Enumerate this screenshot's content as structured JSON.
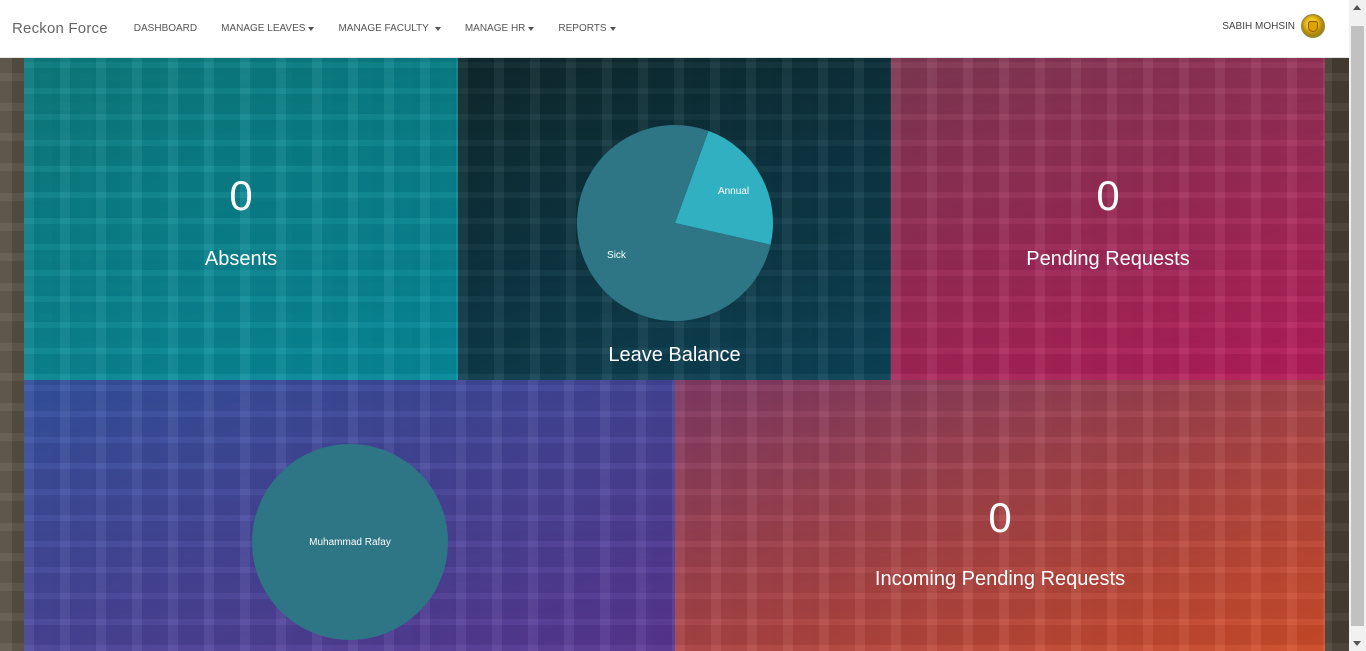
{
  "navbar": {
    "brand": "Reckon Force",
    "items": [
      {
        "label": "DASHBOARD",
        "dropdown": false
      },
      {
        "label": "MANAGE LEAVES",
        "dropdown": true
      },
      {
        "label": "MANAGE FACULTY",
        "dropdown": true
      },
      {
        "label": "MANAGE HR",
        "dropdown": true
      },
      {
        "label": "REPORTS",
        "dropdown": true
      }
    ],
    "user_name": "SABIH MOHSIN"
  },
  "tiles": {
    "absents": {
      "value": "0",
      "label": "Absents"
    },
    "leave_balance": {
      "label": "Leave Balance"
    },
    "pending": {
      "value": "0",
      "label": "Pending Requests"
    },
    "incoming": {
      "value": "0",
      "label": "Incoming Pending Requests"
    }
  },
  "chart_data": [
    {
      "type": "pie",
      "categories": [
        "Annual",
        "Sick"
      ],
      "values": [
        23,
        77
      ],
      "colors": [
        "#30b0c0",
        "#2e7585"
      ]
    },
    {
      "type": "pie",
      "categories": [
        "Muhammad Rafay"
      ],
      "values": [
        100
      ],
      "colors": [
        "#2e7585"
      ]
    }
  ],
  "colors": {
    "absents": "#00939f",
    "leave_balance": "#0b3d4c",
    "pending": "#c2185b",
    "faculty": "#4a46a8",
    "incoming": "#d9532f"
  }
}
